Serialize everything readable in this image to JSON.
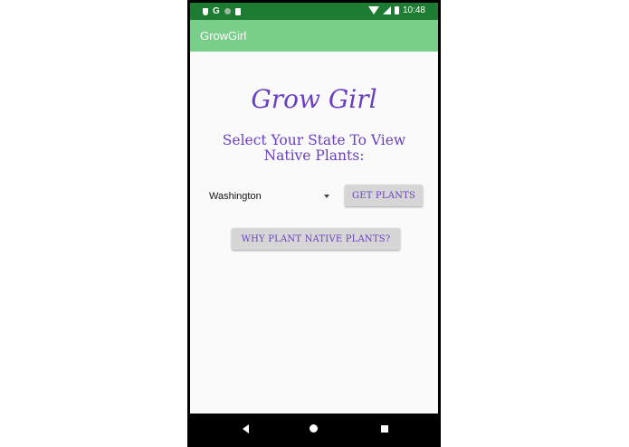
{
  "status_bar": {
    "time": "10:48",
    "left_icons": [
      "shield-icon",
      "google-icon",
      "circle-icon",
      "sd-card-icon"
    ],
    "right_icons": [
      "wifi-icon",
      "signal-icon",
      "battery-icon"
    ],
    "google_letter": "G"
  },
  "app_bar": {
    "title": "GrowGirl"
  },
  "main": {
    "heading": "Grow Girl",
    "subtitle_line1": "Select Your State To View",
    "subtitle_line2": "Native Plants:",
    "state_select": {
      "selected": "Washington"
    },
    "get_plants_label": "GET PLANTS",
    "why_native_label": "WHY PLANT NATIVE PLANTS?"
  },
  "colors": {
    "status_bar": "#1e7c32",
    "app_bar": "#79cf8a",
    "accent_text": "#6a3fc1",
    "button_bg": "#d6d6d6"
  }
}
